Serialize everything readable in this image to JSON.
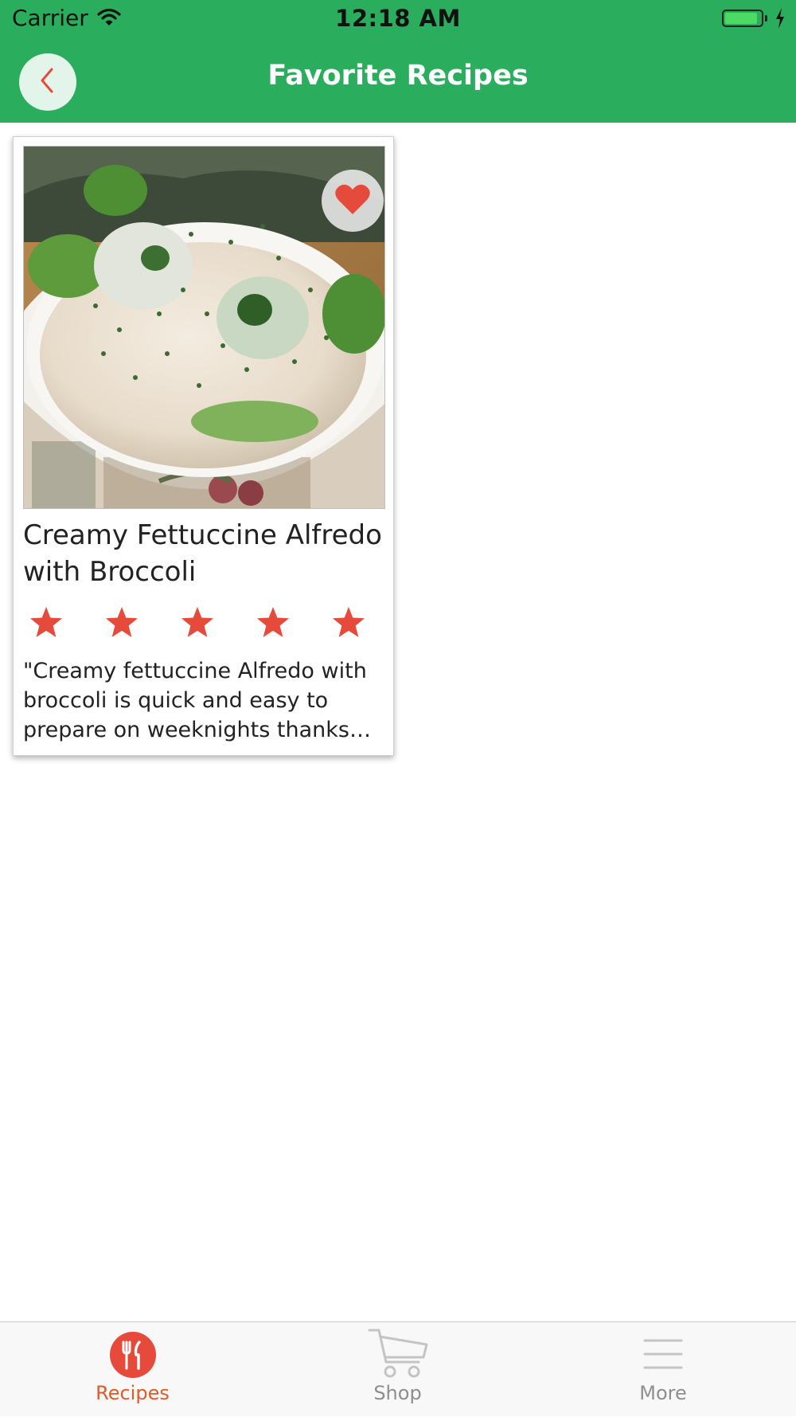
{
  "status_bar": {
    "carrier": "Carrier",
    "time": "12:18 AM",
    "battery_level": 0.9,
    "icons": [
      "wifi-icon",
      "battery-icon",
      "charging-bolt-icon"
    ]
  },
  "nav": {
    "title": "Favorite Recipes",
    "back_icon": "chevron-left-icon"
  },
  "recipes": [
    {
      "title": "Creamy Fettuccine Alfredo with Broccoli",
      "rating": 5,
      "rating_max": 5,
      "description": "\"Creamy fettuccine Alfredo with broccoli is quick and easy to prepare on weeknights thanks t…",
      "favorited": true,
      "favorite_icon": "heart-icon"
    }
  ],
  "tab_bar": {
    "tabs": [
      {
        "label": "Recipes",
        "icon": "fork-knife-icon",
        "active": true
      },
      {
        "label": "Shop",
        "icon": "cart-icon",
        "active": false
      },
      {
        "label": "More",
        "icon": "menu-icon",
        "active": false
      }
    ]
  },
  "colors": {
    "header_green": "#2bad5e",
    "accent_red": "#e64a3b",
    "active_tab": "#e05a2a",
    "inactive_tab": "#8e8e8e"
  }
}
